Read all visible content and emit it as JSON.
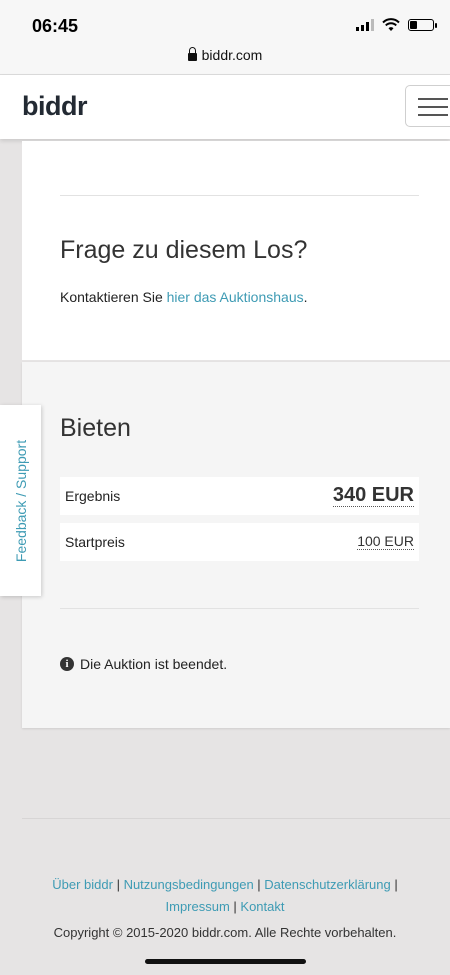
{
  "status_bar": {
    "time": "06:45"
  },
  "url_bar": {
    "domain": "biddr.com"
  },
  "header": {
    "logo": "biddr",
    "menu_icon": "hamburger-icon"
  },
  "question": {
    "title": "Frage zu diesem Los?",
    "text_prefix": "Kontaktieren Sie ",
    "link": "hier das Auktionshaus",
    "text_suffix": "."
  },
  "bid": {
    "title": "Bieten",
    "result_label": "Ergebnis",
    "result_value": "340 EUR",
    "start_label": "Startpreis",
    "start_value": "100 EUR",
    "info_icon": "info-circle-icon",
    "info_text": "Die Auktion ist beendet."
  },
  "feedback": {
    "label": "Feedback / Support"
  },
  "footer": {
    "links": [
      "Über biddr",
      "Nutzungsbedingungen",
      "Datenschutzerklärung",
      "Impressum",
      "Kontakt"
    ],
    "copyright": "Copyright © 2015-2020 biddr.com. Alle Rechte vorbehalten."
  },
  "colors": {
    "link": "#3e9bb4",
    "text": "#222222",
    "background": "#e6e4e4"
  }
}
